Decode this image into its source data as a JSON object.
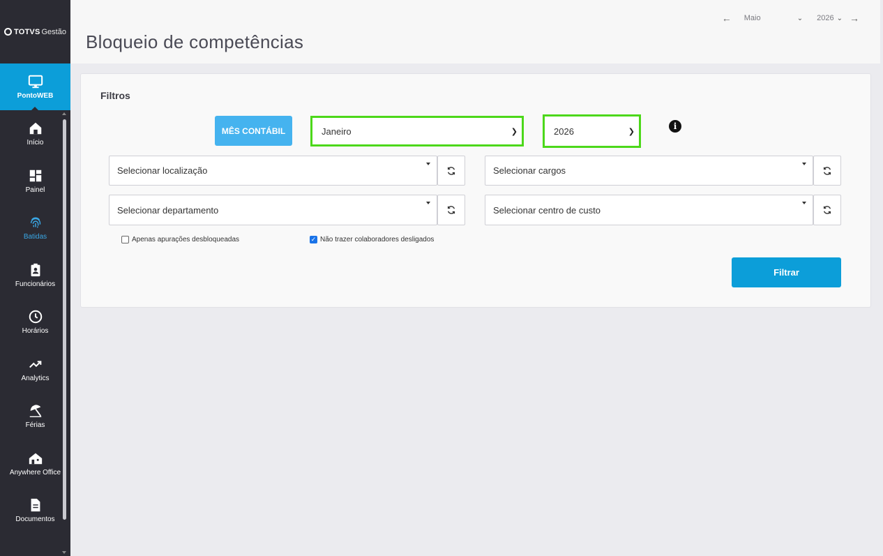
{
  "logo": {
    "brand": "TOTVS",
    "sub": "Gestão"
  },
  "sidebar": {
    "items": [
      {
        "label": "PontoWEB",
        "icon": "monitor-icon"
      },
      {
        "label": "Início",
        "icon": "home-icon"
      },
      {
        "label": "Painel",
        "icon": "dashboard-icon"
      },
      {
        "label": "Batidas",
        "icon": "fingerprint-icon"
      },
      {
        "label": "Funcionários",
        "icon": "badge-icon"
      },
      {
        "label": "Horários",
        "icon": "clock-icon"
      },
      {
        "label": "Analytics",
        "icon": "trend-icon"
      },
      {
        "label": "Férias",
        "icon": "umbrella-icon"
      },
      {
        "label": "Anywhere Office",
        "icon": "house-icon"
      },
      {
        "label": "Documentos",
        "icon": "document-icon"
      }
    ]
  },
  "header": {
    "title": "Bloqueio de competências",
    "period": {
      "month": "Maio",
      "year": "2026"
    }
  },
  "filters": {
    "title": "Filtros",
    "mes_contabil": "MÊS CONTÁBIL",
    "month_value": "Janeiro",
    "year_value": "2026",
    "localizacao": "Selecionar localização",
    "cargos": "Selecionar cargos",
    "departamento": "Selecionar departamento",
    "centro_custo": "Selecionar centro de custo",
    "chk_desbloqueadas": "Apenas apurações desbloqueadas",
    "chk_desligados": "Não trazer colaboradores desligados",
    "filtrar": "Filtrar"
  },
  "colors": {
    "accent": "#0c9ed9",
    "sidebar": "#2b2b33",
    "highlight": "#4cd81a"
  }
}
